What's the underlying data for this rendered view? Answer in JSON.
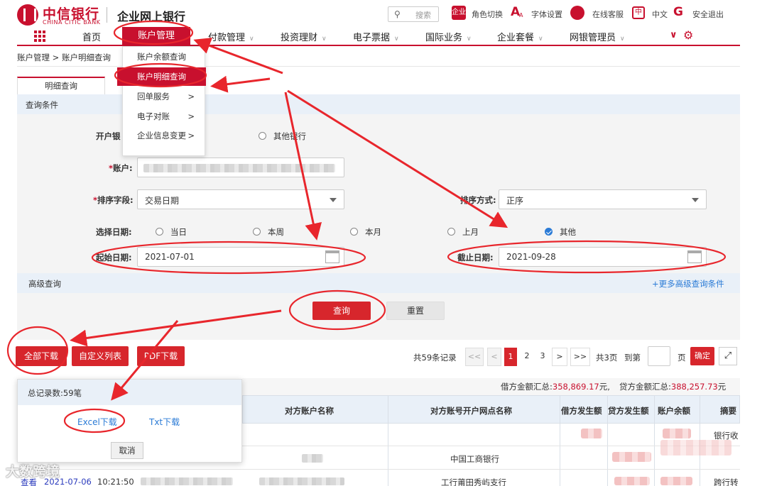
{
  "brand": {
    "name_cn": "中信银行",
    "name_en": "CHINA CITIC BANK",
    "app_title": "企业网上银行",
    "color": "#c8102e"
  },
  "header": {
    "search_placeholder": "搜索",
    "links": [
      {
        "label": "角色切换",
        "icon": "role-switch-icon"
      },
      {
        "label": "字体设置",
        "icon": "font-settings-icon"
      },
      {
        "label": "在线客服",
        "icon": "customer-service-icon"
      },
      {
        "label": "中文",
        "icon": "language-icon"
      },
      {
        "label": "安全退出",
        "icon": "logout-icon"
      }
    ],
    "role_icon_text": "企业"
  },
  "nav": {
    "home": "首页",
    "active": "账户管理",
    "items": [
      "付款管理",
      "投资理财",
      "电子票据",
      "国际业务",
      "企业套餐",
      "网银管理员"
    ]
  },
  "menu": {
    "items": [
      {
        "label": "账户余额查询",
        "arrow": ""
      },
      {
        "label": "账户明细查询",
        "arrow": ""
      },
      {
        "label": "回单服务",
        "arrow": ">"
      },
      {
        "label": "电子对账",
        "arrow": ">"
      },
      {
        "label": "企业信息变更",
        "arrow": ">"
      }
    ]
  },
  "breadcrumb": "账户管理 > 账户明细查询",
  "tab": "明细查询",
  "query": {
    "section_title": "查询条件",
    "bank_label": "开户银",
    "other_bank": "其他银行",
    "account_label": "账户:",
    "sort_field_label": "排序字段:",
    "sort_field_value": "交易日期",
    "sort_order_label": "排序方式:",
    "sort_order_value": "正序",
    "date_choice_label": "选择日期:",
    "date_options": [
      "当日",
      "本周",
      "本月",
      "上月",
      "其他"
    ],
    "date_selected": "其他",
    "start_label": "起始日期:",
    "start_value": "2021-07-01",
    "end_label": "截止日期:",
    "end_value": "2021-09-28",
    "required_mark": "*"
  },
  "advanced": {
    "title": "高级查询",
    "more": "+更多高级查询条件"
  },
  "buttons": {
    "query": "查询",
    "reset": "重置",
    "download_all": "全部下载",
    "custom_columns": "自定义列表",
    "pdf_download": "PDF下载"
  },
  "pager": {
    "total_text": "共59条记录",
    "first": "<<",
    "prev": "<",
    "pages": [
      "1",
      "2",
      "3"
    ],
    "current": "1",
    "next": ">",
    "last": ">>",
    "total_pages": "共3页",
    "goto": "到第",
    "page_unit": "页",
    "confirm": "确定"
  },
  "summary": {
    "debit_label": "借方金额汇总:",
    "debit_value": "358,869.17",
    "debit_unit": "元,",
    "credit_label": "贷方金额汇总:",
    "credit_value": "388,257.73",
    "credit_unit": "元"
  },
  "table": {
    "headers": [
      "对方账户名称",
      "对方账号开户网点名称",
      "借方发生额",
      "贷方发生额",
      "账户余额",
      "摘要"
    ],
    "rows": [
      {
        "branch": "",
        "memo": "银行收"
      },
      {
        "branch": "中国工商银行",
        "memo": ""
      },
      {
        "view": "查看",
        "date": "2021-07-06",
        "time": "10:21:50",
        "branch": "工行莆田秀屿支行",
        "memo": "跨行转"
      }
    ]
  },
  "popup": {
    "total": "总记录数:59笔",
    "excel": "Excel下载",
    "txt": "Txt下载",
    "cancel": "取消"
  },
  "watermark": "大数跨境"
}
